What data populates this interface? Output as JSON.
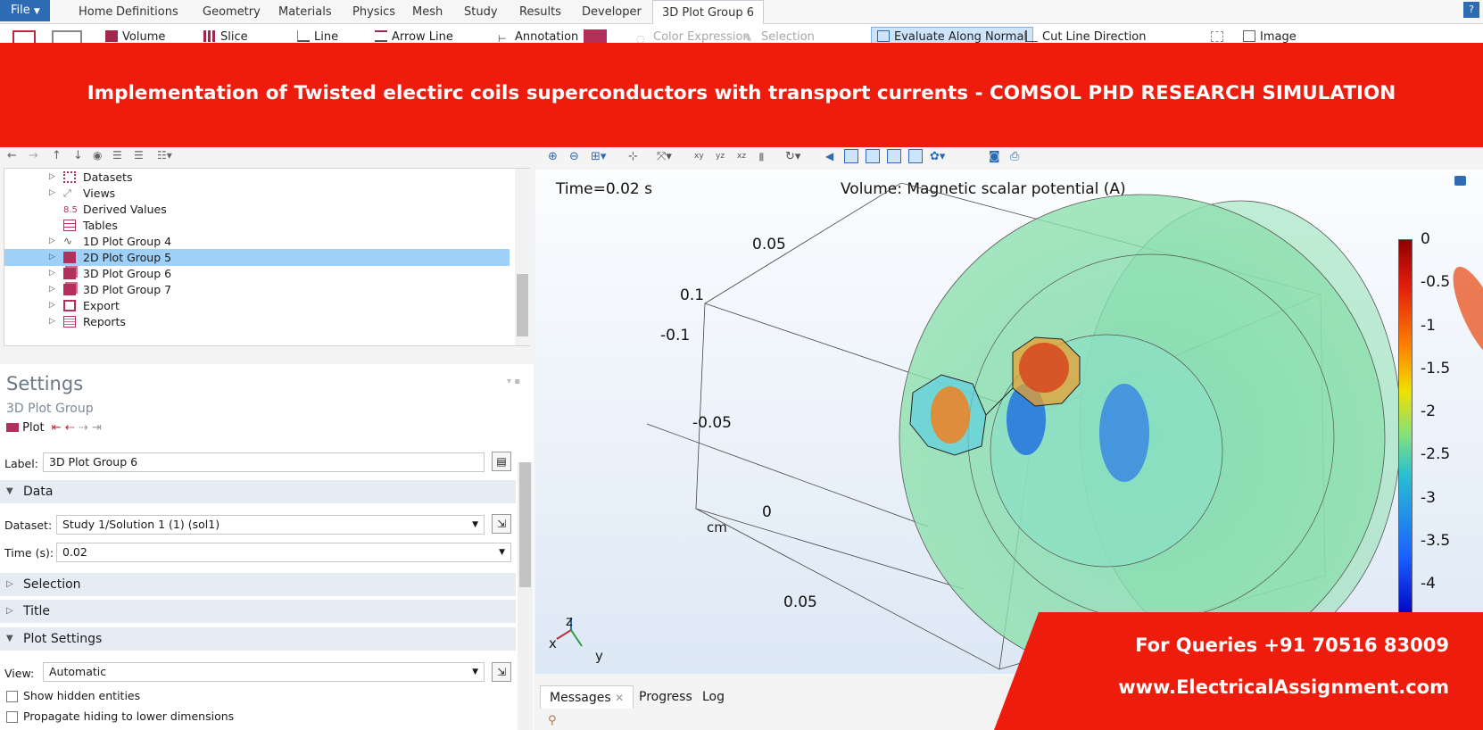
{
  "menubar": {
    "file": "File",
    "tabs": [
      "Home",
      "Definitions",
      "Geometry",
      "Materials",
      "Physics",
      "Mesh",
      "Study",
      "Results",
      "Developer",
      "3D Plot Group 6"
    ],
    "help": "?"
  },
  "ribbon": {
    "volume": "Volume",
    "slice": "Slice",
    "line": "Line",
    "arrow_line": "Arrow Line",
    "annotation": "Annotation",
    "color_expression": "Color Expression",
    "selection": "Selection",
    "evaluate_along_normal": "Evaluate Along Normal",
    "cut_line_direction": "Cut Line Direction",
    "image": "Image"
  },
  "banner": {
    "text": "Implementation of Twisted electirc coils superconductors with transport currents - COMSOL PHD RESEARCH SIMULATION"
  },
  "tree": {
    "items": [
      {
        "label": "Datasets",
        "icon": "datasets-icon"
      },
      {
        "label": "Views",
        "icon": "views-icon"
      },
      {
        "label": "Derived Values",
        "icon": "derived-values-icon"
      },
      {
        "label": "Tables",
        "icon": "tables-icon"
      },
      {
        "label": "1D Plot Group 4",
        "icon": "plot1d-icon"
      },
      {
        "label": "2D Plot Group 5",
        "icon": "plot2d-icon"
      },
      {
        "label": "3D Plot Group 6",
        "icon": "plot3d-icon"
      },
      {
        "label": "3D Plot Group 7",
        "icon": "plot3d-icon"
      },
      {
        "label": "Export",
        "icon": "export-icon"
      },
      {
        "label": "Reports",
        "icon": "reports-icon"
      }
    ]
  },
  "settings": {
    "title": "Settings",
    "subtitle": "3D Plot Group",
    "plot": "Plot",
    "label_caption": "Label:",
    "label_value": "3D Plot Group 6",
    "sections": {
      "data": "Data",
      "selection": "Selection",
      "title": "Title",
      "plot_settings": "Plot Settings"
    },
    "dataset_caption": "Dataset:",
    "dataset_value": "Study 1/Solution 1 (1) (sol1)",
    "time_caption": "Time (s):",
    "time_value": "0.02",
    "view_caption": "View:",
    "view_value": "Automatic",
    "show_hidden": "Show hidden entities",
    "propagate": "Propagate hiding to lower dimensions"
  },
  "graphics": {
    "time_label": "Time=0.02 s",
    "plot_title": "Volume: Magnetic scalar potential (A)",
    "axis_labels": [
      "0.05",
      "0.1",
      "-0.1",
      "-0.05",
      "0",
      "0.05"
    ],
    "unit": "cm",
    "triad": {
      "z": "z",
      "x": "x",
      "y": "y"
    },
    "colorbar_labels": [
      "0",
      "-0.5",
      "-1",
      "-1.5",
      "-2",
      "-2.5",
      "-3",
      "-3.5",
      "-4"
    ]
  },
  "messages": {
    "tabs": [
      "Messages",
      "Progress",
      "Log"
    ]
  },
  "promo": {
    "line1": "For Queries +91 70516 83009",
    "line2": "www.ElectricalAssignment.com"
  }
}
